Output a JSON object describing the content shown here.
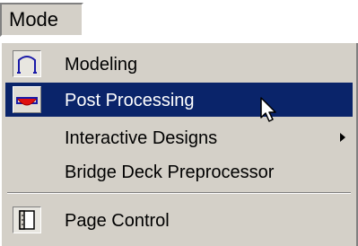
{
  "menubar": {
    "title": "Mode"
  },
  "menu": {
    "items": [
      {
        "label": "Modeling",
        "icon": "modeling-icon"
      },
      {
        "label": "Post Processing",
        "icon": "post-processing-icon",
        "highlighted": true
      },
      {
        "label": "Interactive Designs",
        "has_submenu": true
      },
      {
        "label": "Bridge Deck Preprocessor"
      },
      {
        "label": "Page Control",
        "icon": "page-control-icon"
      }
    ]
  },
  "colors": {
    "menu_bg": "#d4d0c8",
    "highlight_bg": "#0a246a",
    "highlight_text": "#ffffff"
  }
}
